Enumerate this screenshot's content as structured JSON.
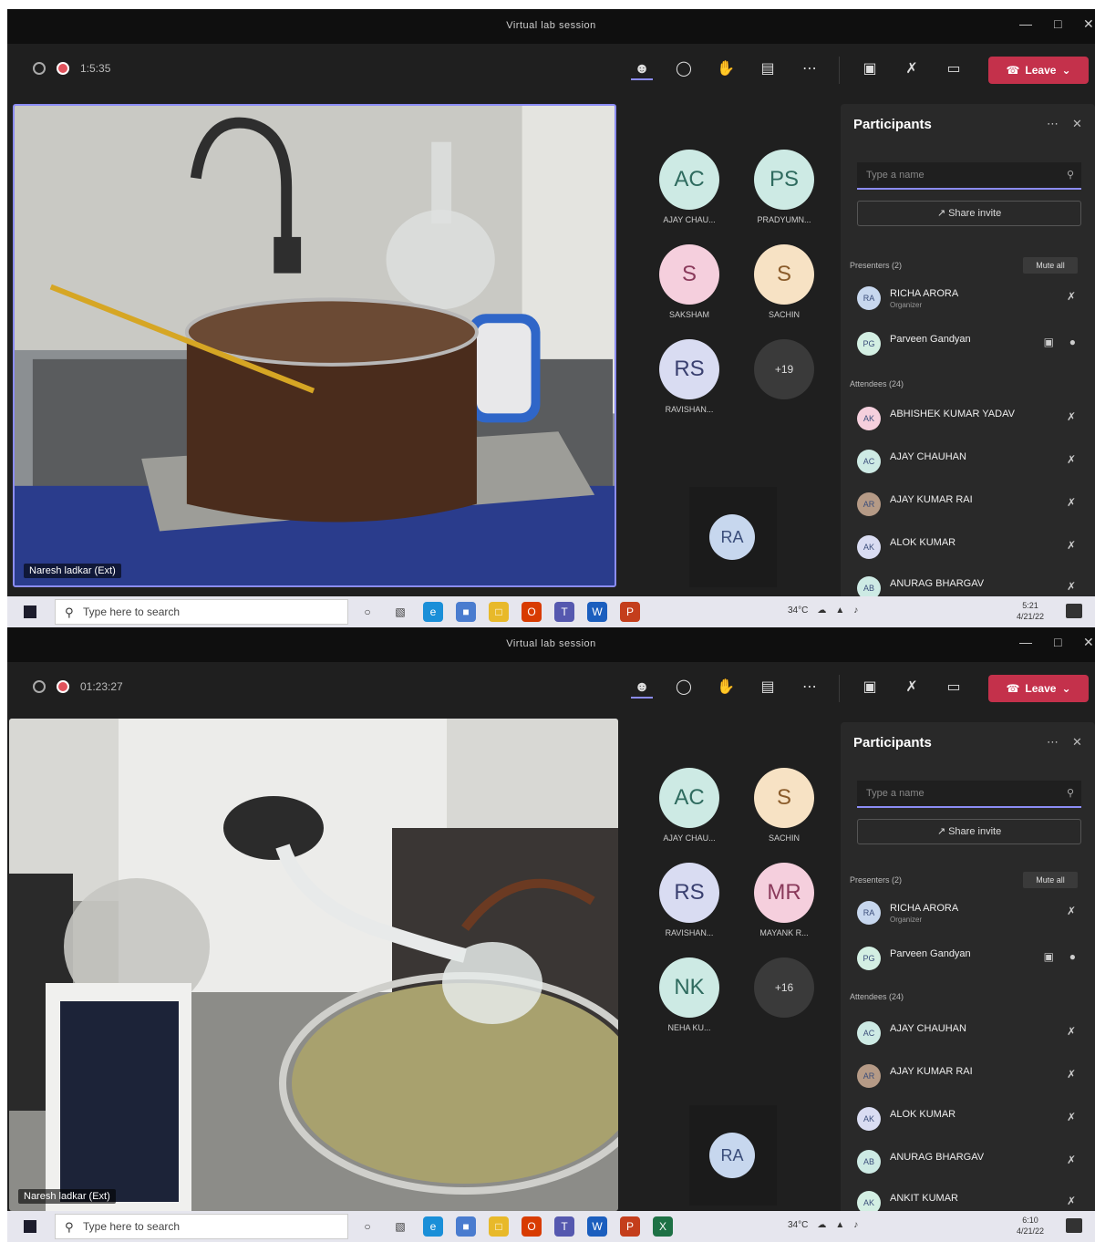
{
  "window": {
    "title": "Virtual lab session"
  },
  "screens": [
    {
      "timer": "1:5:35",
      "presenter_name": "Naresh ladkar (Ext)",
      "tiles": [
        {
          "initials": "AC",
          "name": "AJAY CHAU...",
          "bg": "#cdeae4",
          "fg": "#2f6b5f"
        },
        {
          "initials": "PS",
          "name": "PRADYUMN...",
          "bg": "#cdeae4",
          "fg": "#2f6b5f"
        },
        {
          "initials": "S",
          "name": "SAKSHAM",
          "bg": "#f5cfdd",
          "fg": "#8a3a5b"
        },
        {
          "initials": "S",
          "name": "SACHIN",
          "bg": "#f7e2c4",
          "fg": "#8a5b2a"
        },
        {
          "initials": "RS",
          "name": "RAVISHAN...",
          "bg": "#d9dcf2",
          "fg": "#3a4070"
        },
        {
          "initials": "+19",
          "name": "",
          "bg": "#3a3a3a",
          "fg": "#ddd"
        }
      ],
      "panel": {
        "presenters_label": "Presenters (2)",
        "attendees_label": "Attendees (24)",
        "participants": [
          {
            "name": "RICHA ARORA",
            "role": "Organizer",
            "initials": "RA",
            "bg": "#c7d7ee",
            "section": "presenter"
          },
          {
            "name": "Parveen Gandyan",
            "role": "",
            "initials": "PG",
            "bg": "#d3efe3",
            "section": "presenter"
          },
          {
            "name": "ABHISHEK KUMAR YADAV",
            "role": "",
            "initials": "AK",
            "bg": "#f5cfdd",
            "section": "attendee"
          },
          {
            "name": "AJAY CHAUHAN",
            "role": "",
            "initials": "AC",
            "bg": "#cdeae4",
            "section": "attendee"
          },
          {
            "name": "AJAY KUMAR RAI",
            "role": "",
            "initials": "AR",
            "bg": "#b59a86",
            "section": "attendee"
          },
          {
            "name": "ALOK KUMAR",
            "role": "",
            "initials": "AK",
            "bg": "#d9dcf2",
            "section": "attendee"
          },
          {
            "name": "ANURAG BHARGAV",
            "role": "",
            "initials": "AB",
            "bg": "#cdeae4",
            "section": "attendee"
          }
        ]
      },
      "clock": {
        "time": "5:21",
        "date": "4/21/22"
      }
    },
    {
      "timer": "01:23:27",
      "presenter_name": "Naresh ladkar (Ext)",
      "tiles": [
        {
          "initials": "AC",
          "name": "AJAY CHAU...",
          "bg": "#cdeae4",
          "fg": "#2f6b5f"
        },
        {
          "initials": "S",
          "name": "SACHIN",
          "bg": "#f7e2c4",
          "fg": "#8a5b2a"
        },
        {
          "initials": "RS",
          "name": "RAVISHAN...",
          "bg": "#d9dcf2",
          "fg": "#3a4070"
        },
        {
          "initials": "MR",
          "name": "MAYANK R...",
          "bg": "#f5cfdd",
          "fg": "#8a3a5b"
        },
        {
          "initials": "NK",
          "name": "NEHA KU...",
          "bg": "#cdeae4",
          "fg": "#2f6b5f"
        },
        {
          "initials": "+16",
          "name": "",
          "bg": "#3a3a3a",
          "fg": "#ddd"
        }
      ],
      "panel": {
        "presenters_label": "Presenters (2)",
        "attendees_label": "Attendees (24)",
        "participants": [
          {
            "name": "RICHA ARORA",
            "role": "Organizer",
            "initials": "RA",
            "bg": "#c7d7ee",
            "section": "presenter"
          },
          {
            "name": "Parveen Gandyan",
            "role": "",
            "initials": "PG",
            "bg": "#d3efe3",
            "section": "presenter"
          },
          {
            "name": "AJAY CHAUHAN",
            "role": "",
            "initials": "AC",
            "bg": "#cdeae4",
            "section": "attendee"
          },
          {
            "name": "AJAY KUMAR RAI",
            "role": "",
            "initials": "AR",
            "bg": "#b59a86",
            "section": "attendee"
          },
          {
            "name": "ALOK KUMAR",
            "role": "",
            "initials": "AK",
            "bg": "#d9dcf2",
            "section": "attendee"
          },
          {
            "name": "ANURAG BHARGAV",
            "role": "",
            "initials": "AB",
            "bg": "#cdeae4",
            "section": "attendee"
          },
          {
            "name": "ANKIT KUMAR",
            "role": "",
            "initials": "AK",
            "bg": "#d3efe3",
            "section": "attendee"
          }
        ]
      },
      "clock": {
        "time": "6:10",
        "date": "4/21/22"
      }
    }
  ],
  "common": {
    "leave_label": "Leave",
    "participants_title": "Participants",
    "search_placeholder": "Type a name",
    "share_invite": "Share invite",
    "mute_all": "Mute all",
    "speaker_initials": "RA",
    "taskbar_search": "Type here to search",
    "weather": "34°C"
  },
  "colors": {
    "accent": "#8b8cf5",
    "leave": "#c4314b",
    "background": "#1f1f1f"
  }
}
